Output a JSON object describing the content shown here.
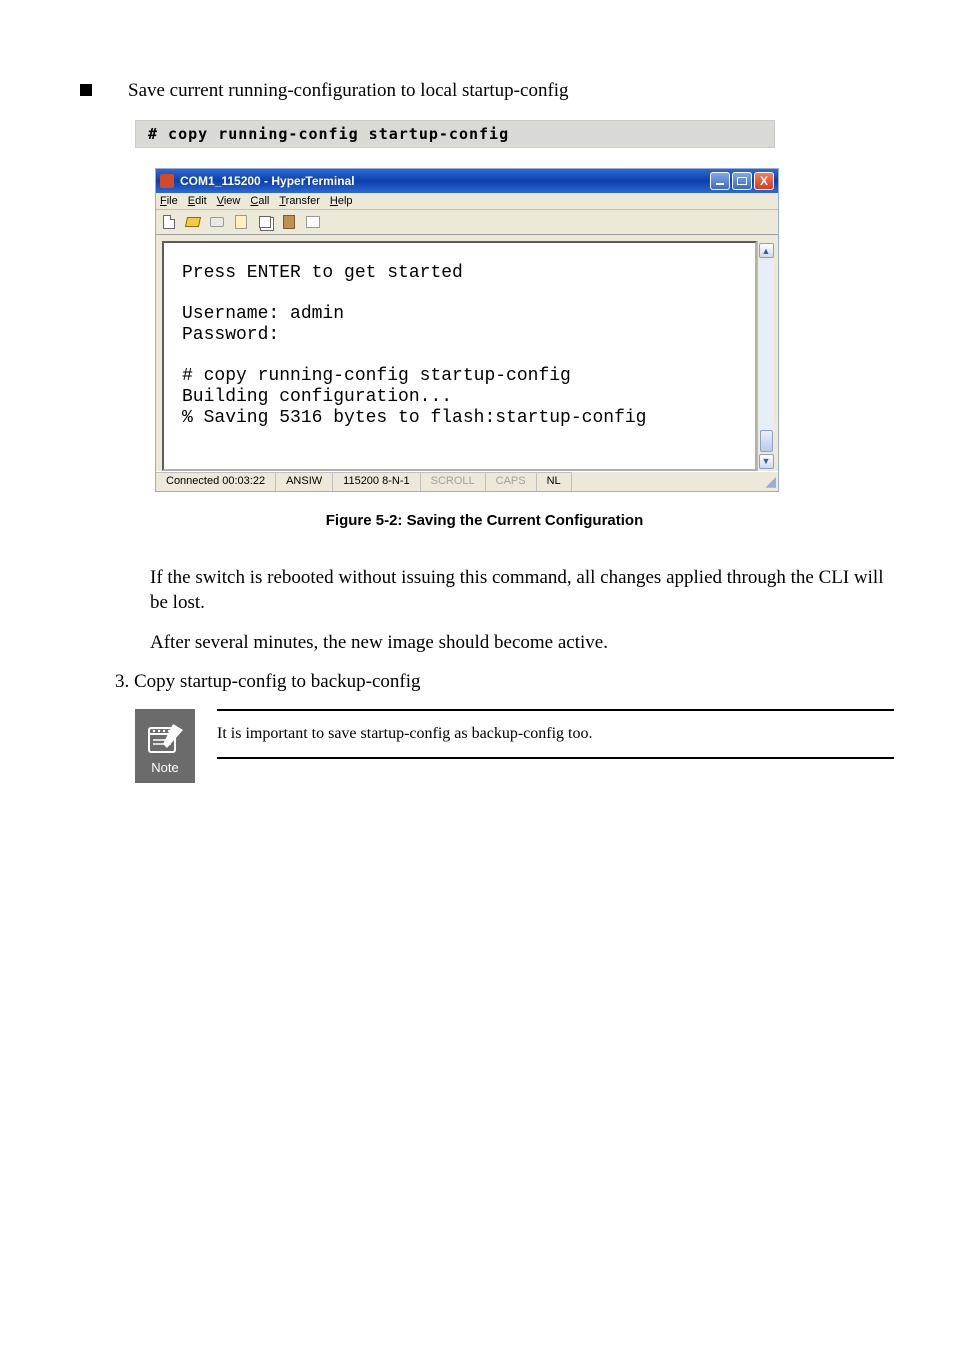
{
  "bullet_text": "Save current running-configuration to local startup-config",
  "code_line": "# copy running-config startup-config",
  "window": {
    "title": "COM1_115200 - HyperTerminal",
    "menu": [
      "File",
      "Edit",
      "View",
      "Call",
      "Transfer",
      "Help"
    ],
    "terminal_text": "Press ENTER to get started\n\nUsername: admin\nPassword:\n\n# copy running-config startup-config\nBuilding configuration...\n% Saving 5316 bytes to flash:startup-config",
    "status": {
      "conn": "Connected 00:03:22",
      "emul": "ANSIW",
      "params": "115200 8-N-1",
      "scroll": "SCROLL",
      "caps": "CAPS",
      "nl": "NL"
    }
  },
  "fig_caption": "Figure 5-2: Saving the Current Configuration",
  "para1": "If the switch is rebooted without issuing this command, all changes applied through the CLI will be lost.",
  "para2": "After several minutes, the new image should become active.",
  "para3": "3. Copy startup-config to backup-config",
  "note_text": "It is important to save startup-config as backup-config too."
}
